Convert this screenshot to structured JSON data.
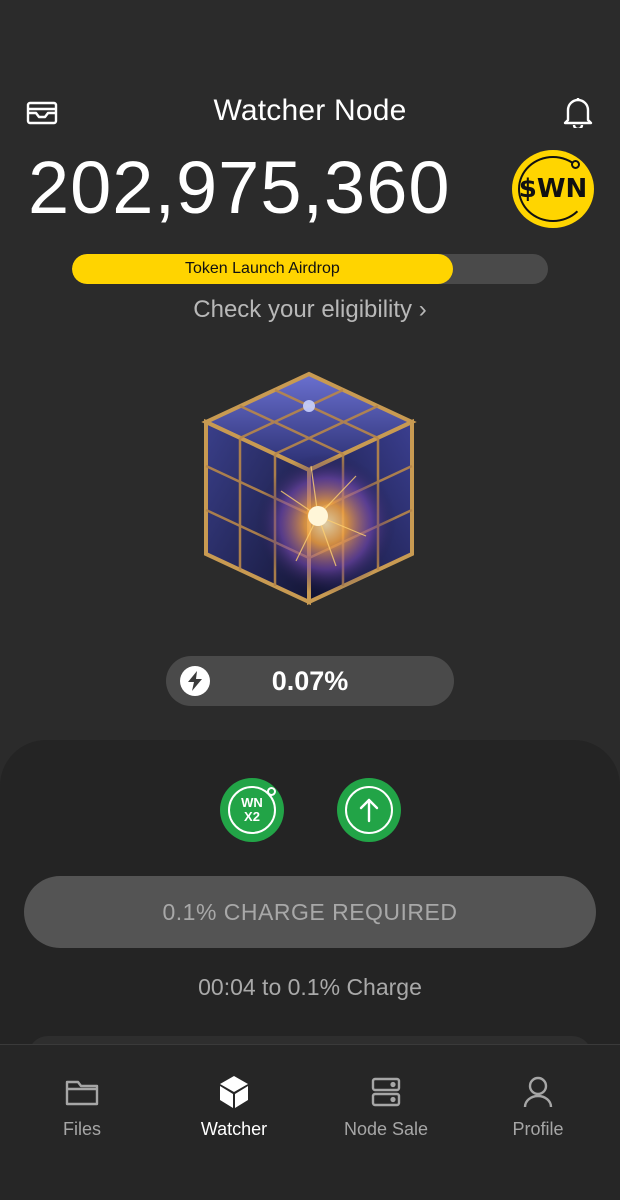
{
  "header": {
    "title": "Watcher Node",
    "left_icon": "wallet-icon",
    "right_icon": "bell-icon"
  },
  "balance": {
    "amount": "202,975,360",
    "token_label": "$WN"
  },
  "airdrop": {
    "label": "Token Launch Airdrop",
    "progress": 0.8,
    "eligibility_link": "Check your eligibility ›"
  },
  "node": {
    "image": "glowing-node-cube",
    "charge_percent": "0.07%",
    "charge_icon": "bolt-icon"
  },
  "actions": {
    "boost_label_top": "WN",
    "boost_label_bottom": "X2",
    "upgrade_icon": "arrow-up-icon"
  },
  "charge": {
    "button_label": "0.1% CHARGE REQUIRED",
    "timer_text": "00:04 to 0.1% Charge"
  },
  "colors": {
    "accent": "#ffd400",
    "action_green": "#22a447",
    "background": "#2b2b2b"
  },
  "bottom_nav": {
    "items": [
      {
        "label": "Files",
        "icon": "folder-icon",
        "active": false
      },
      {
        "label": "Watcher",
        "icon": "cube-icon",
        "active": true
      },
      {
        "label": "Node Sale",
        "icon": "server-icon",
        "active": false
      },
      {
        "label": "Profile",
        "icon": "user-icon",
        "active": false
      }
    ]
  }
}
